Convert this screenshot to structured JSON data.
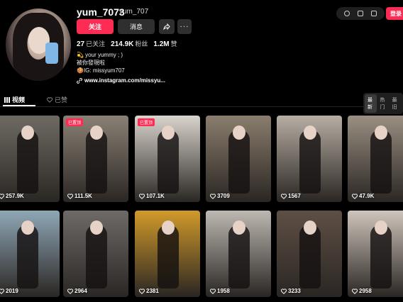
{
  "profile": {
    "username": "yum_7073",
    "nickname": "yum_707",
    "follow_label": "关注",
    "message_label": "消息",
    "more_label": "···",
    "stats": [
      {
        "value": "27",
        "label": "已关注"
      },
      {
        "value": "214.9K",
        "label": "粉丝"
      },
      {
        "value": "1.2M",
        "label": "赞"
      }
    ],
    "bio_lines": [
      "💫 your yummy ; )",
      "被你發現啦",
      "🍪IG: missyum707"
    ],
    "link": "www.instagram.com/missyu..."
  },
  "header": {
    "login_label": "登录"
  },
  "tabs": {
    "videos": "视频",
    "liked": "已赞"
  },
  "sort": [
    "最新",
    "热门",
    "最旧"
  ],
  "videos": [
    {
      "views": "257.9K",
      "pinned": "",
      "bg": "#6e6a63"
    },
    {
      "views": "111.5K",
      "pinned": "已置顶",
      "bg": "#8a8175"
    },
    {
      "views": "107.1K",
      "pinned": "已置顶",
      "bg": "#d9d4cc"
    },
    {
      "views": "3709",
      "pinned": "",
      "bg": "#8a7d6c"
    },
    {
      "views": "1567",
      "pinned": "",
      "bg": "#b7aea4"
    },
    {
      "views": "47.9K",
      "pinned": "",
      "bg": "#9a8f82"
    },
    {
      "views": "2019",
      "pinned": "",
      "bg": "#8fa7b6"
    },
    {
      "views": "2964",
      "pinned": "",
      "bg": "#6d6a67"
    },
    {
      "views": "2381",
      "pinned": "",
      "bg": "#d19a2a"
    },
    {
      "views": "1958",
      "pinned": "",
      "bg": "#bdb8b1"
    },
    {
      "views": "3233",
      "pinned": "",
      "bg": "#5e4f45"
    },
    {
      "views": "2958",
      "pinned": "",
      "bg": "#cfc5bc"
    }
  ]
}
